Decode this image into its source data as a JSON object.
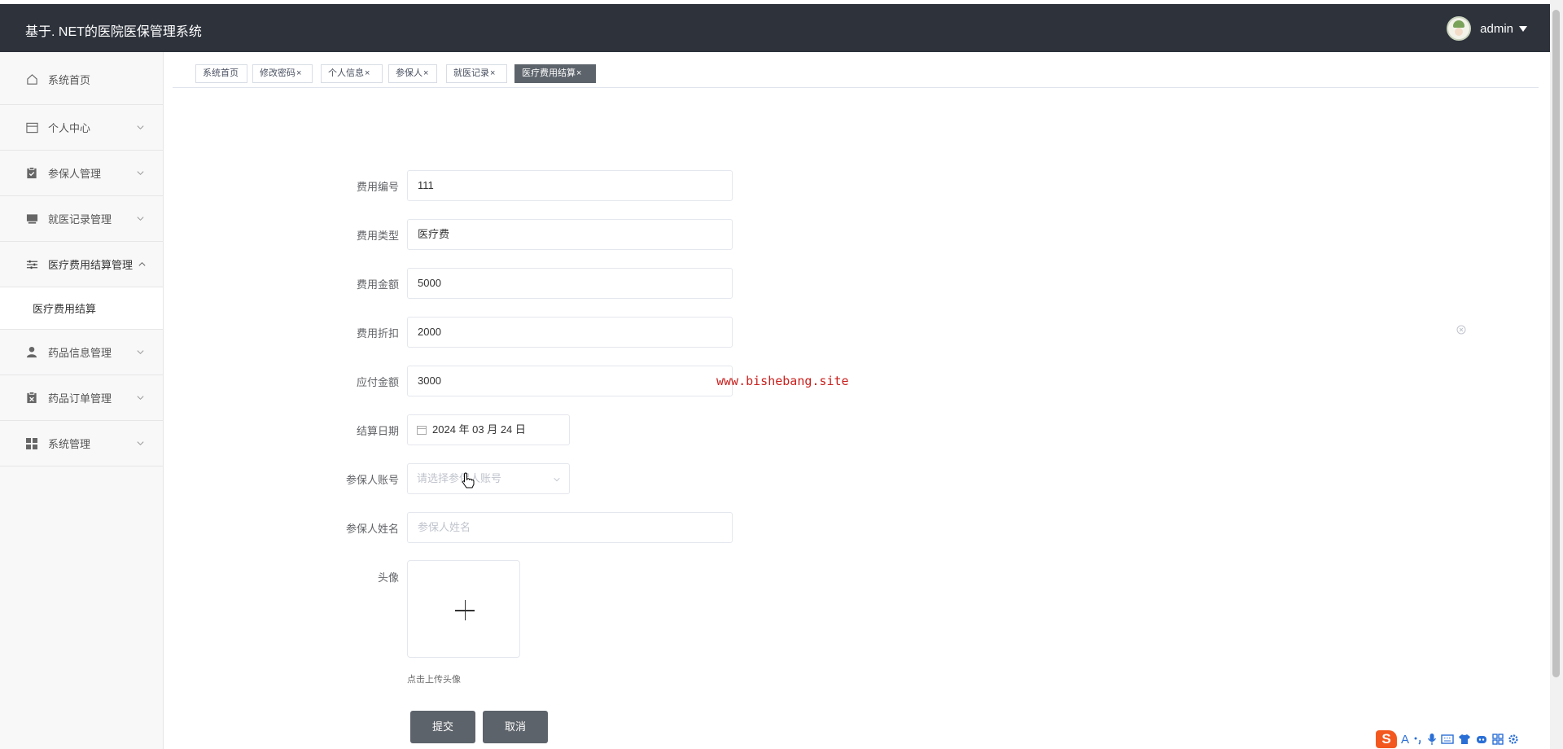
{
  "header": {
    "app_title": "基于. NET的医院医保管理系统",
    "user_name": "admin"
  },
  "sidebar": {
    "items": [
      {
        "label": "系统首页",
        "icon": "home-icon"
      },
      {
        "label": "个人中心",
        "icon": "card-icon"
      },
      {
        "label": "参保人管理",
        "icon": "clipboard-icon"
      },
      {
        "label": "就医记录管理",
        "icon": "monitor-icon"
      },
      {
        "label": "医疗费用结算管理",
        "icon": "sliders-icon"
      },
      {
        "label": "药品信息管理",
        "icon": "user-icon"
      },
      {
        "label": "药品订单管理",
        "icon": "clipboard-x-icon"
      },
      {
        "label": "系统管理",
        "icon": "grid-icon"
      }
    ],
    "active_submenu": "医疗费用结算"
  },
  "tabs": [
    {
      "label": "系统首页",
      "closable": false
    },
    {
      "label": "修改密码",
      "closable": true
    },
    {
      "label": "个人信息",
      "closable": true
    },
    {
      "label": "参保人",
      "closable": true
    },
    {
      "label": "就医记录",
      "closable": true
    },
    {
      "label": "医疗费用结算",
      "closable": true,
      "active": true
    }
  ],
  "tab_close_glyph": "×",
  "form": {
    "fee_number": {
      "label": "费用编号",
      "value": "111"
    },
    "fee_type": {
      "label": "费用类型",
      "value": "医疗费"
    },
    "fee_amount": {
      "label": "费用金额",
      "value": "5000"
    },
    "fee_discount": {
      "label": "费用折扣",
      "value": "2000"
    },
    "payable_amount": {
      "label": "应付金额",
      "value": "3000"
    },
    "settlement_date": {
      "label": "结算日期",
      "value": "2024 年 03 月 24 日"
    },
    "insured_account": {
      "label": "参保人账号",
      "placeholder": "请选择参保人账号"
    },
    "insured_name": {
      "label": "参保人姓名",
      "placeholder": "参保人姓名"
    },
    "avatar": {
      "label": "头像",
      "tip": "点击上传头像"
    },
    "submit_label": "提交",
    "cancel_label": "取消"
  },
  "watermark": "www.bishebang.site",
  "ime": {
    "logo": "S",
    "mode": "A"
  },
  "colors": {
    "header_bg": "#2d323b",
    "active_tab": "#5c636b",
    "button": "#5d636a",
    "watermark": "#c9211e"
  }
}
